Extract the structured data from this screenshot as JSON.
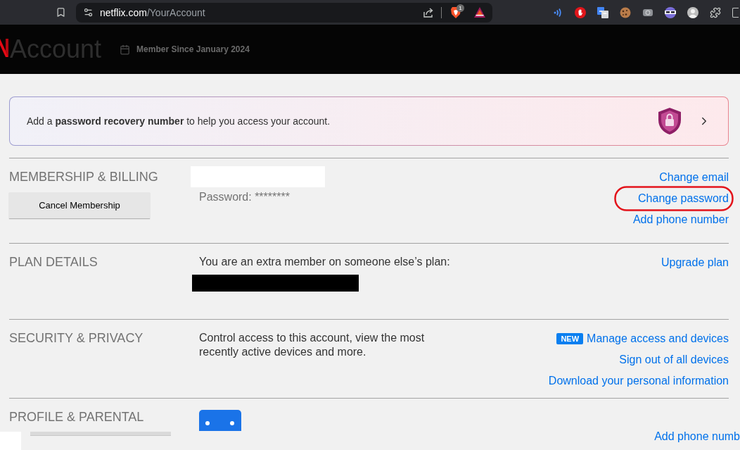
{
  "browser": {
    "host": "netflix.com",
    "path": "/YourAccount",
    "shield_badge": "1"
  },
  "header": {
    "title": "Account",
    "member_since": "Member Since January 2024"
  },
  "banner": {
    "text": "Add a **password recovery number** to help you access your account."
  },
  "sections": [
    {
      "heading": "MEMBERSHIP & BILLING",
      "button": "Cancel Membership",
      "details": [
        {
          "kind": "redacted_light"
        },
        {
          "kind": "muted_text",
          "text": "Password: ********"
        }
      ],
      "links": [
        {
          "label": "Change email"
        },
        {
          "label": "Change password",
          "circled": true
        },
        {
          "label": "Add phone number"
        }
      ]
    },
    {
      "heading": "PLAN DETAILS",
      "details": [
        {
          "kind": "text",
          "text": "You are an extra member on someone else’s plan:"
        },
        {
          "kind": "redacted_dark"
        }
      ],
      "links": [
        {
          "label": "Upgrade plan"
        }
      ]
    },
    {
      "heading": "SECURITY & PRIVACY",
      "details": [
        {
          "kind": "text",
          "text": "Control access to this account, view the most recently active devices and more."
        }
      ],
      "links": [
        {
          "label": "Manage access and devices",
          "badge": "NEW"
        },
        {
          "label": "Sign out of all devices"
        },
        {
          "label": "Download your personal information"
        }
      ]
    },
    {
      "heading": "PROFILE & PARENTAL",
      "details": [
        {
          "kind": "avatar"
        }
      ]
    }
  ],
  "bottom_strip": {
    "link": "Add phone numb"
  }
}
